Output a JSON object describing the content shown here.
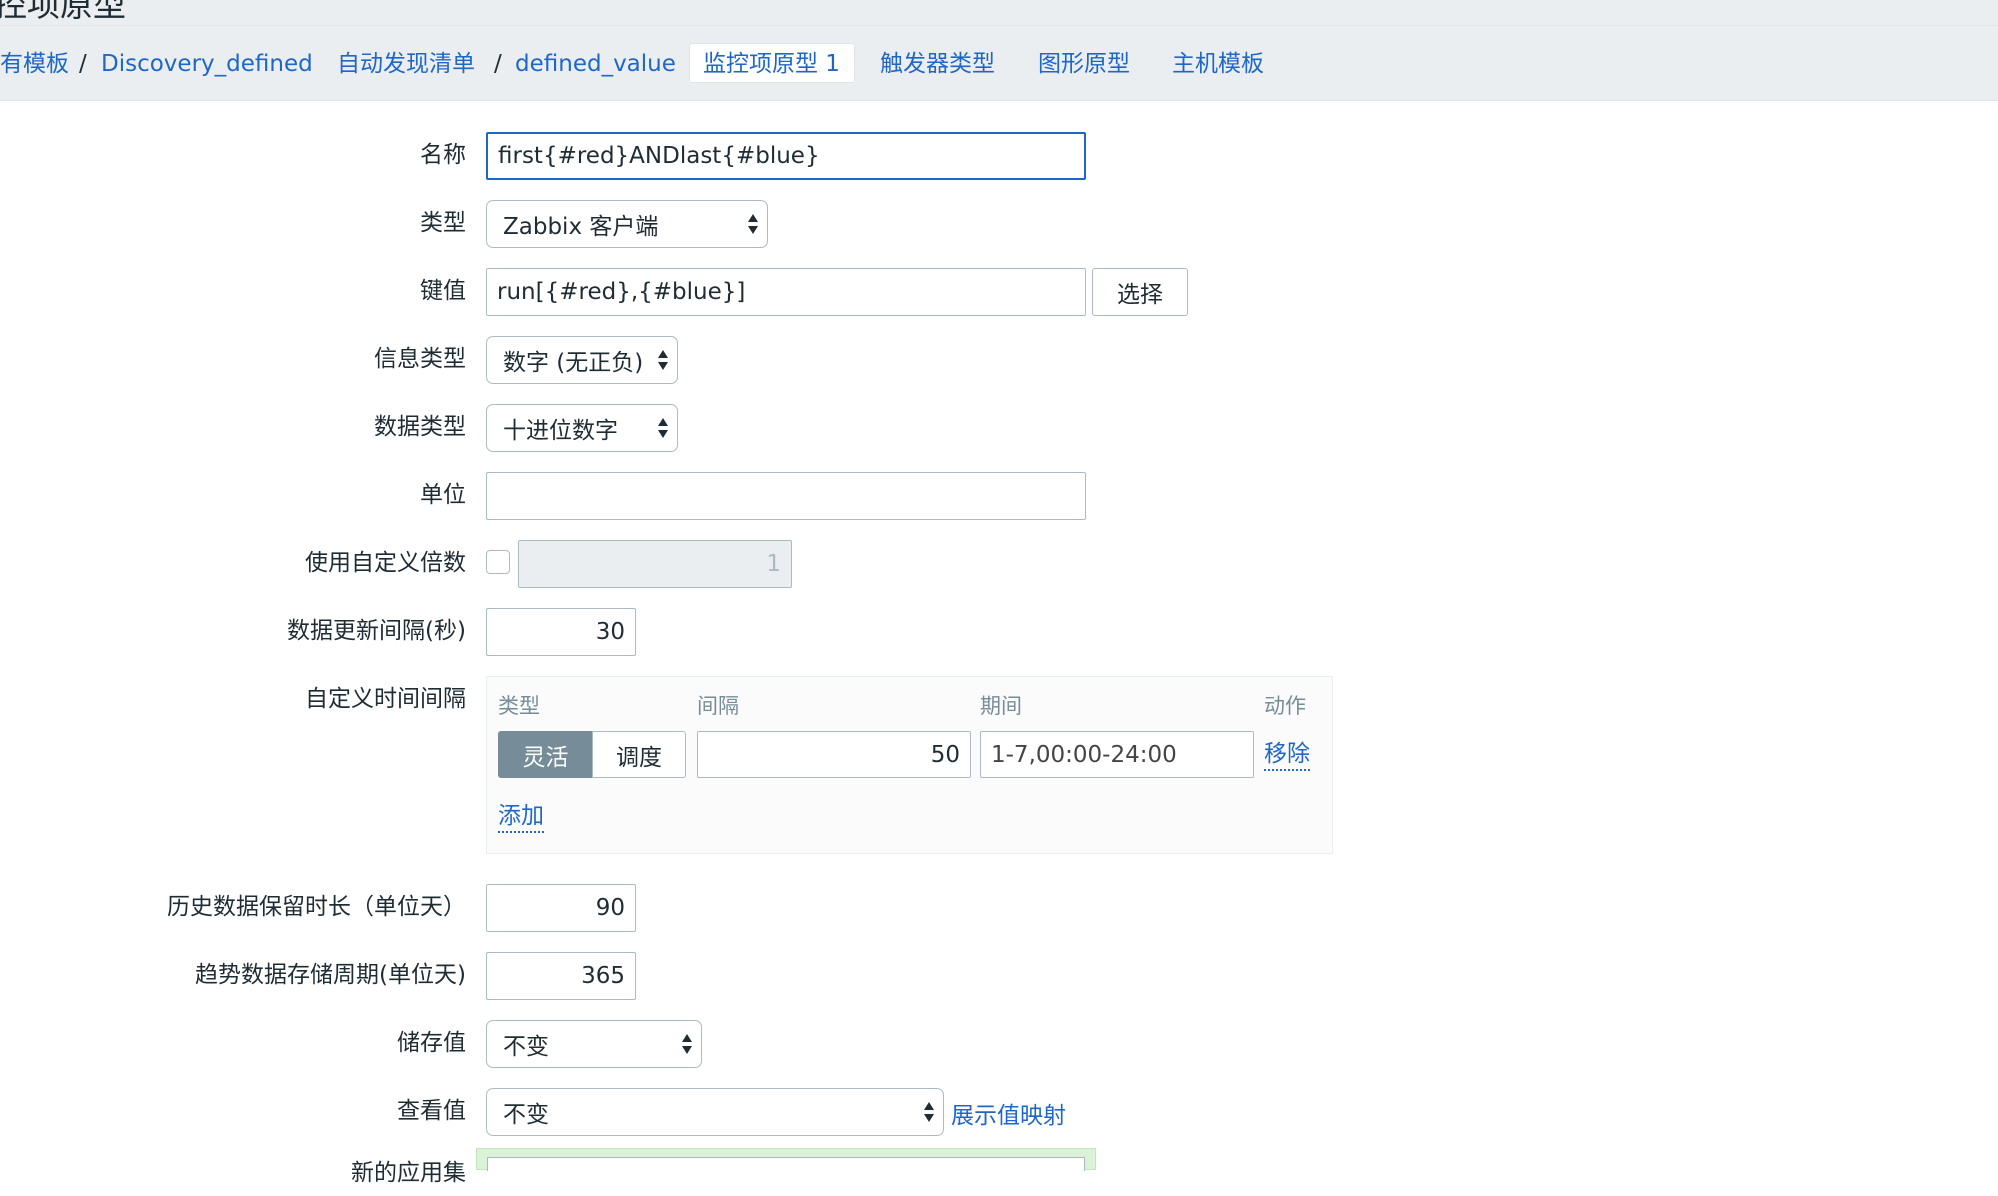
{
  "page": {
    "title_partial": "控项原型"
  },
  "nav": {
    "breadcrumb": [
      "有模板",
      "Discovery_defined"
    ],
    "breadcrumb_sep": "/",
    "rule_links": [
      "自动发现清单",
      "defined_value"
    ],
    "tabs": [
      {
        "label": "监控项原型 1",
        "active": true
      },
      {
        "label": "触发器类型",
        "active": false
      },
      {
        "label": "图形原型",
        "active": false
      },
      {
        "label": "主机模板",
        "active": false
      }
    ]
  },
  "form": {
    "name": {
      "label": "名称",
      "value": "first{#red}ANDlast{#blue}"
    },
    "type": {
      "label": "类型",
      "value": "Zabbix 客户端"
    },
    "key": {
      "label": "键值",
      "value": "run[{#red},{#blue}]",
      "button": "选择"
    },
    "info_type": {
      "label": "信息类型",
      "value": "数字 (无正负)"
    },
    "data_type": {
      "label": "数据类型",
      "value": "十进位数字"
    },
    "units": {
      "label": "单位",
      "value": ""
    },
    "multiplier": {
      "label": "使用自定义倍数",
      "checked": false,
      "value": "1"
    },
    "update_interval": {
      "label": "数据更新间隔(秒)",
      "value": "30"
    },
    "custom_intervals": {
      "label": "自定义时间间隔",
      "headers": {
        "type": "类型",
        "interval": "间隔",
        "period": "期间",
        "action": "动作"
      },
      "rows": [
        {
          "type_options": [
            "灵活",
            "调度"
          ],
          "selected": "灵活",
          "interval": "50",
          "period": "1-7,00:00-24:00",
          "action": "移除"
        }
      ],
      "add": "添加"
    },
    "history": {
      "label": "历史数据保留时长（单位天）",
      "value": "90"
    },
    "trends": {
      "label": "趋势数据存储周期(单位天)",
      "value": "365"
    },
    "store_value": {
      "label": "储存值",
      "value": "不变"
    },
    "show_value": {
      "label": "查看值",
      "value": "不变",
      "link": "展示值映射"
    },
    "next_label_partial": "新的应用集"
  },
  "colors": {
    "link": "#1e67c9",
    "active_toggle": "#768d99",
    "border": "#acbbc2",
    "header_bg": "#ebeef0",
    "highlight_bg": "#dcf2d8"
  }
}
